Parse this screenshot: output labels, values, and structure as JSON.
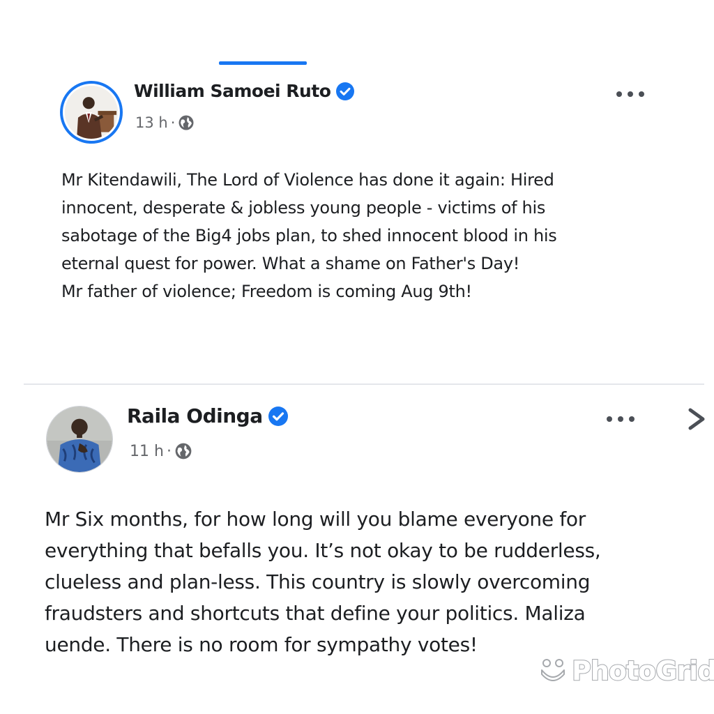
{
  "post_1": {
    "author": "William Samoei Ruto",
    "verified": true,
    "time": "13 h",
    "separator": "·",
    "audience_icon": "globe-icon",
    "body": "Mr Kitendawili, The Lord of Violence has done it again: Hired\ninnocent, desperate & jobless young people - victims of his\nsabotage of the Big4 jobs plan, to shed innocent blood in his\neternal quest for power. What a shame on Father's Day!\nMr father of violence; Freedom is coming Aug 9th!"
  },
  "post_2": {
    "author": "Raila Odinga",
    "verified": true,
    "time": "11 h",
    "separator": "·",
    "audience_icon": "globe-icon",
    "body": "Mr Six months, for how long will you blame everyone for\neverything that befalls you. It’s not okay to be rudderless,\nclueless and plan-less. This country is slowly overcoming\nfraudsters and shortcuts that define your politics. Maliza\nuende. There is no room for sympathy votes!"
  },
  "watermark": {
    "text": "PhotoGrid"
  },
  "colors": {
    "accent": "#1877f2",
    "text": "#1c1e21",
    "meta": "#65676b",
    "divider": "#e4e6eb"
  }
}
